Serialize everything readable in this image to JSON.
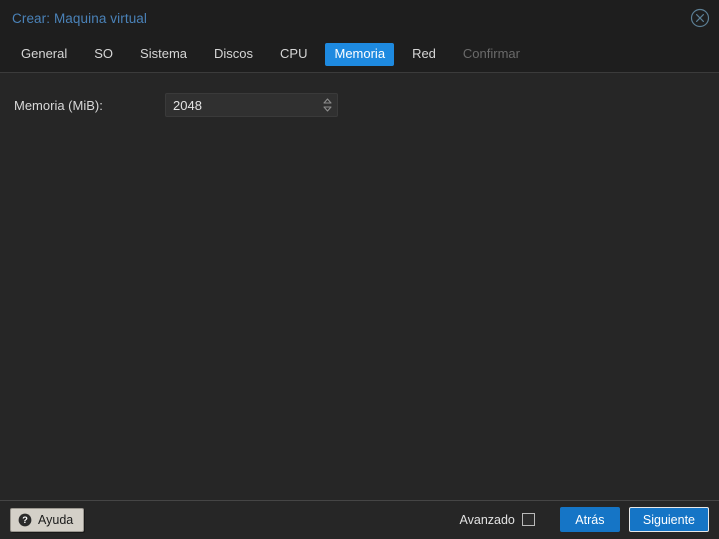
{
  "window": {
    "title": "Crear: Maquina virtual",
    "close_icon": "close-circle-icon"
  },
  "tabs": [
    {
      "label": "General",
      "state": "normal"
    },
    {
      "label": "SO",
      "state": "normal"
    },
    {
      "label": "Sistema",
      "state": "normal"
    },
    {
      "label": "Discos",
      "state": "normal"
    },
    {
      "label": "CPU",
      "state": "normal"
    },
    {
      "label": "Memoria",
      "state": "active"
    },
    {
      "label": "Red",
      "state": "normal"
    },
    {
      "label": "Confirmar",
      "state": "disabled"
    }
  ],
  "form": {
    "memory": {
      "label": "Memoria (MiB):",
      "value": "2048",
      "placeholder": "2048",
      "spinner_icon": "spinner-updown-icon"
    }
  },
  "footer": {
    "help_label": "Ayuda",
    "help_icon": "question-mark-icon",
    "advanced_label": "Avanzado",
    "advanced_checked": false,
    "back_label": "Atrás",
    "next_label": "Siguiente"
  },
  "colors": {
    "accent": "#1e8ae0",
    "button_blue": "#1575c6",
    "title_blue": "#4a82b8",
    "window_bg": "#262626",
    "header_bg": "#1e1e1e",
    "disabled_text": "#6a6a6a"
  }
}
